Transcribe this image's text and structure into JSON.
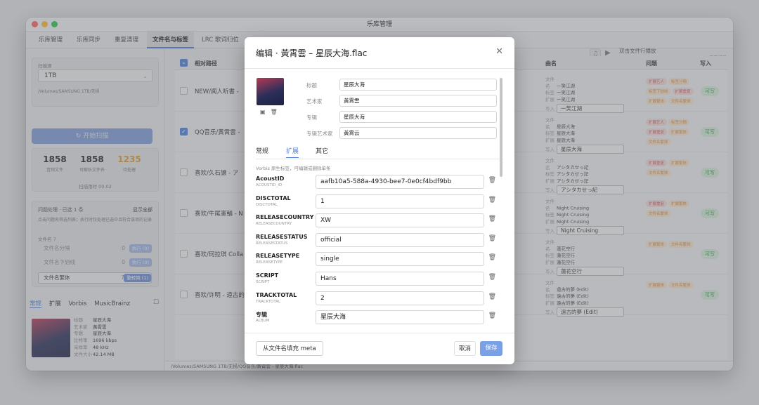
{
  "window": {
    "title": "乐库管理"
  },
  "tabs": [
    {
      "label": "乐库管理"
    },
    {
      "label": "乐库同步"
    },
    {
      "label": "重复清理"
    },
    {
      "label": "文件名与标签"
    },
    {
      "label": "LRC 歌词归位"
    }
  ],
  "player": {
    "title": "双击文件行播放",
    "status": "未在播放",
    "note_icon": "♫",
    "play_icon": "▶"
  },
  "sidebar": {
    "scan_source_label": "扫描源",
    "scan_source_value": "1TB",
    "scan_path": "/Volumes/SAMSUNG 1TB/无损",
    "scan_button": "开始扫描",
    "stats": [
      {
        "value": "1858",
        "label": "音频文件"
      },
      {
        "value": "1858",
        "label": "可解析文件名"
      },
      {
        "value": "1235",
        "label": "待处理"
      }
    ],
    "scan_time": "扫描用时 00:02",
    "issues_title": "问题处理 · 已选 1 条",
    "show_all": "显示全部",
    "issues_hint": "点击问题名筛选列表；执行时仅处理已选中且符合该项的记录",
    "filename_count_label": "文件名 7",
    "issues": [
      {
        "label": "文件名分隔",
        "count": "0",
        "button": "执行 (0)"
      },
      {
        "label": "文件名下划线",
        "count": "0",
        "button": "执行 (0)"
      },
      {
        "label": "文件名繁体",
        "count": "7",
        "button": "繁转简 (1)"
      }
    ],
    "bottom_tabs": [
      "常规",
      "扩展",
      "Vorbis",
      "MusicBrainz"
    ],
    "meta": [
      {
        "k": "标题",
        "v": "星辰大海"
      },
      {
        "k": "艺术家",
        "v": "黃霄雲"
      },
      {
        "k": "专辑",
        "v": "星辰大海"
      },
      {
        "k": "比特率",
        "v": "1696 kbps"
      },
      {
        "k": "采样率",
        "v": "48 kHz"
      },
      {
        "k": "文件大小",
        "v": "42.14 MB"
      }
    ]
  },
  "table": {
    "headers": {
      "path": "相对路径",
      "song": "曲名",
      "issues": "问题",
      "write": "写入"
    },
    "field_labels": {
      "file": "文件名",
      "tag": "标签",
      "ext": "扩展",
      "write": "写入"
    },
    "rows": [
      {
        "path": "NEW/闻人听書 - ",
        "file": "一笑江湖",
        "tag": "一笑江湖",
        "ext": "一笑江湖",
        "write": "一笑江湖",
        "badges": [
          "扩展艺人",
          "标签分隔",
          "标签下划线",
          "扩展重复",
          "扩展繁体",
          "文件名繁体"
        ],
        "checked": false,
        "writable": "可写"
      },
      {
        "path": "QQ音乐/黃霄雲 - ",
        "file": "星辰大海",
        "tag": "星辰大海",
        "ext": "星辰大海",
        "write": "星辰大海",
        "badges": [
          "扩展艺人",
          "标签分隔",
          "扩展重复",
          "扩展繁体",
          "文件名繁体"
        ],
        "checked": true,
        "writable": "可写"
      },
      {
        "path": "喜欢/久石譲 - ア",
        "file": "アシタカせっ記",
        "tag": "アシタカせっ記",
        "ext": "アシタカせっ記",
        "write": "アシタカせっ記",
        "badges": [
          "扩展重复",
          "扩展繁体",
          "文件名繁体"
        ],
        "checked": false,
        "writable": "可写"
      },
      {
        "path": "喜欢/牛尾憲輔 - N",
        "file": "Night Cruising",
        "tag": "Night Cruising",
        "ext": "Night Cruising",
        "write": "Night Cruising",
        "badges": [
          "扩展重复",
          "扩展繁体",
          "文件名繁体"
        ],
        "checked": false,
        "writable": "可写"
      },
      {
        "path": "喜欢/珂拉琪 Colla",
        "file": "蓮花空行",
        "tag": "蓮花空行",
        "ext": "蓮花空行",
        "write": "蓮花空行",
        "badges": [
          "扩展繁体",
          "文件名繁体"
        ],
        "checked": false,
        "writable": "可写"
      },
      {
        "path": "喜欢/许明 - 遠古的",
        "file": "遠古的夢 (Edit)",
        "tag": "遠古的夢 (Edit)",
        "ext": "遠古的夢 (Edit)",
        "write": "遠古的夢 (Edit)",
        "badges": [
          "扩展繁体",
          "文件名繁体"
        ],
        "checked": false,
        "writable": "可写"
      }
    ]
  },
  "pathbar": "/Volumes/SAMSUNG 1TB/无损/QQ音乐/黃霄雲 - 星辰大海.flac",
  "modal": {
    "title": "编辑 · 黃霄雲 – 星辰大海.flac",
    "close": "✕",
    "fields": [
      {
        "label": "标题",
        "value": "星辰大海"
      },
      {
        "label": "艺术家",
        "value": "黃霄雲"
      },
      {
        "label": "专辑",
        "value": "星辰大海"
      },
      {
        "label": "专辑艺术家",
        "value": "黃霄云"
      }
    ],
    "tabs": [
      "常规",
      "扩展",
      "其它"
    ],
    "hint": "Vorbis 原生标签，可编辑或删除单条",
    "tags": [
      {
        "key": "AcoustID",
        "sub": "ACOUSTID_ID",
        "value": "aafb10a5-588a-4930-bee7-0e0cf4bdf9bb"
      },
      {
        "key": "DISCTOTAL",
        "sub": "DISCTOTAL",
        "value": "1"
      },
      {
        "key": "RELEASECOUNTRY",
        "sub": "RELEASECOUNTRY",
        "value": "XW"
      },
      {
        "key": "RELEASESTATUS",
        "sub": "RELEASESTATUS",
        "value": "official"
      },
      {
        "key": "RELEASETYPE",
        "sub": "RELEASETYPE",
        "value": "single"
      },
      {
        "key": "SCRIPT",
        "sub": "SCRIPT",
        "value": "Hans"
      },
      {
        "key": "TRACKTOTAL",
        "sub": "TRACKTOTAL",
        "value": "2"
      },
      {
        "key": "专辑",
        "sub": "ALBUM",
        "value": "星辰大海"
      }
    ],
    "fill_button": "从文件名填充 meta",
    "cancel_button": "取消",
    "save_button": "保存"
  }
}
